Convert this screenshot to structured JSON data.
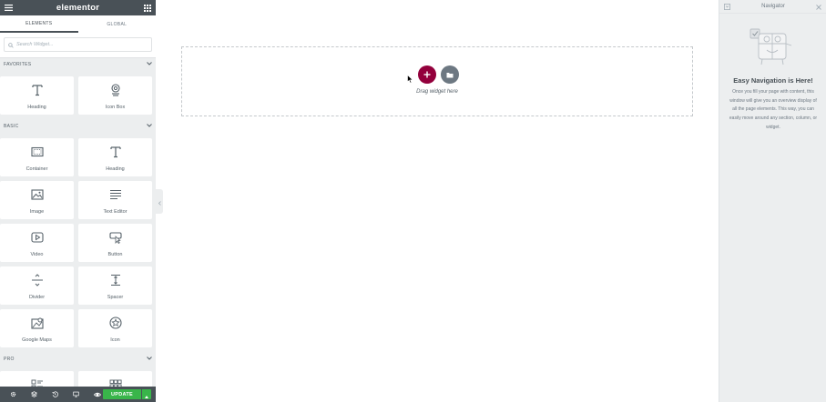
{
  "panel": {
    "logo": "elementor",
    "tabs": [
      {
        "label": "ELEMENTS",
        "active": true
      },
      {
        "label": "GLOBAL",
        "active": false
      }
    ],
    "search_placeholder": "Search Widget...",
    "categories": {
      "favorites": {
        "label": "FAVORITES"
      },
      "basic": {
        "label": "BASIC"
      },
      "pro": {
        "label": "PRO"
      }
    },
    "favorites_widgets": [
      {
        "label": "Heading",
        "icon": "heading-icon"
      },
      {
        "label": "Icon Box",
        "icon": "icon-box-icon"
      }
    ],
    "basic_widgets": [
      {
        "label": "Container",
        "icon": "container-icon"
      },
      {
        "label": "Heading",
        "icon": "heading-icon"
      },
      {
        "label": "Image",
        "icon": "image-icon"
      },
      {
        "label": "Text Editor",
        "icon": "text-editor-icon"
      },
      {
        "label": "Video",
        "icon": "video-icon"
      },
      {
        "label": "Button",
        "icon": "button-icon"
      },
      {
        "label": "Divider",
        "icon": "divider-icon"
      },
      {
        "label": "Spacer",
        "icon": "spacer-icon"
      },
      {
        "label": "Google Maps",
        "icon": "google-maps-icon"
      },
      {
        "label": "Icon",
        "icon": "star-icon"
      }
    ],
    "footer": {
      "update_label": "UPDATE"
    }
  },
  "canvas": {
    "drag_text": "Drag widget here"
  },
  "navigator": {
    "title": "Navigator",
    "empty_heading": "Easy Navigation is Here!",
    "empty_text": "Once you fill your page with content, this window will give you an overview display of all the page elements. This way, you can easily move around any section, column, or widget."
  },
  "colors": {
    "panel_header": "#495157",
    "add_button": "#93003c",
    "update_button": "#39b54a",
    "template_button": "#6d7882"
  }
}
